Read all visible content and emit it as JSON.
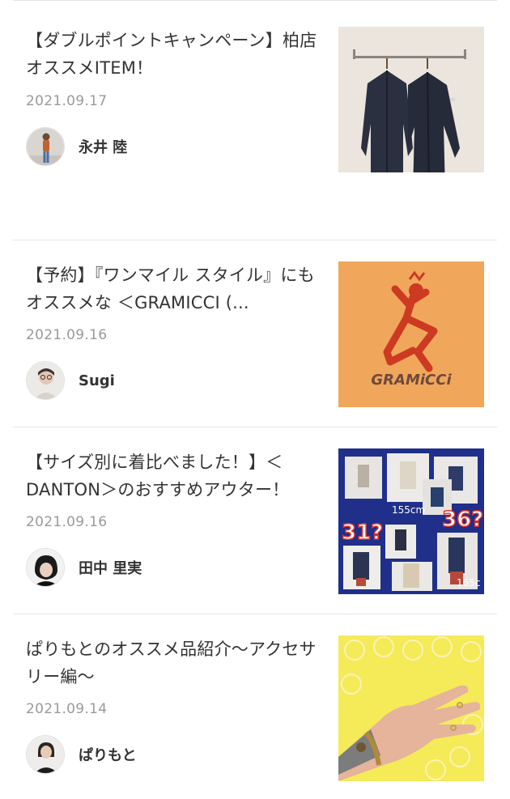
{
  "articles": [
    {
      "title": "【ダブルポイントキャンペーン】柏店オススメITEM！",
      "date": "2021.09.17",
      "author": "永井 陸",
      "thumbnail_icon": "jackets-photo"
    },
    {
      "title": "【予約】『ワンマイル スタイル』にもオススメな ＜GRAMICCI (...",
      "date": "2021.09.16",
      "author": "Sugi",
      "thumbnail_icon": "gramicci-logo",
      "thumbnail_text": "GRAMiCCi"
    },
    {
      "title": "【サイズ別に着比べました！】＜DANTON＞のおすすめアウター！",
      "date": "2021.09.16",
      "author": "田中 里実",
      "thumbnail_icon": "size-comparison-collage",
      "thumbnail_notes": [
        "31?",
        "36?",
        "155cm",
        "165c"
      ]
    },
    {
      "title": "ぱりもとのオススメ品紹介〜アクセサリー編〜",
      "date": "2021.09.14",
      "author": "ぱりもと",
      "thumbnail_icon": "bracelet-hand-photo"
    }
  ],
  "colors": {
    "title_text": "#333333",
    "date_text": "#9a9a9a",
    "divider": "#e6e6e6",
    "gramicci_bg": "#f0a75c",
    "gramicci_red": "#cc3a22",
    "collage_bg": "#1f2f8a",
    "bracelet_bg": "#f5ea58"
  }
}
